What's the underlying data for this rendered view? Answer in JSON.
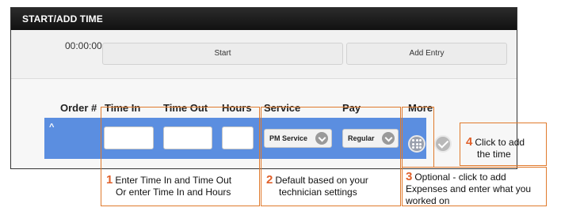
{
  "panel": {
    "title": "START/ADD TIME",
    "timer": "00:00:00",
    "start_label": "Start",
    "add_entry_label": "Add Entry"
  },
  "columns": {
    "order": "Order #",
    "time_in": "Time In",
    "time_out": "Time Out",
    "hours": "Hours",
    "service": "Service",
    "pay": "Pay",
    "more": "More"
  },
  "row": {
    "caret": "^",
    "service_value": "PM Service",
    "pay_value": "Regular"
  },
  "annotations": [
    {
      "num": "1",
      "line1": "Enter Time In and Time Out",
      "line2": "Or enter Time In and Hours"
    },
    {
      "num": "2",
      "line1": "Default based on your",
      "line2": "technician settings"
    },
    {
      "num": "3",
      "line1": "Optional - click to add",
      "line2": "Expenses and enter what you",
      "line3": "worked on"
    },
    {
      "num": "4",
      "line1": "Click to add",
      "line2": "the time"
    }
  ],
  "colors": {
    "header_bg": "#1c1c1c",
    "row_bg": "#5b8ee0",
    "annotation": "#e07a2c"
  },
  "icons": {
    "service_chevron": "chevron-down-icon",
    "pay_chevron": "chevron-down-icon",
    "more": "grid-dots-icon",
    "save": "checkmark-icon"
  }
}
